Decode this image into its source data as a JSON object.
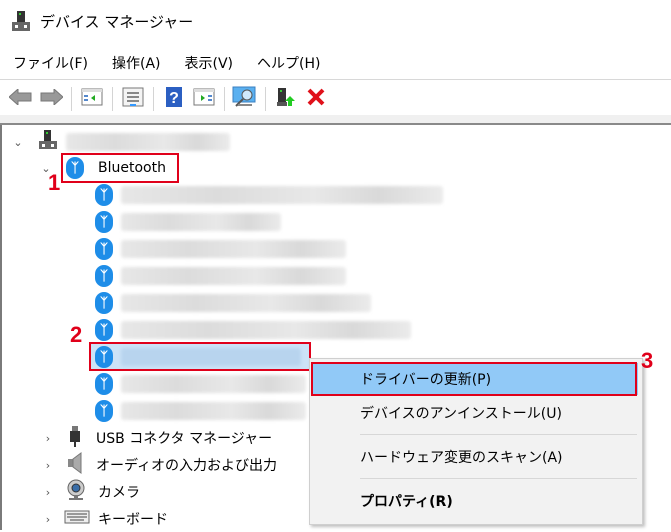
{
  "window": {
    "title": "デバイス マネージャー",
    "app_icon": "device-manager-icon"
  },
  "menubar": {
    "items": [
      {
        "label": "ファイル(F)"
      },
      {
        "label": "操作(A)"
      },
      {
        "label": "表示(V)"
      },
      {
        "label": "ヘルプ(H)"
      }
    ]
  },
  "toolbar": {
    "buttons": [
      {
        "icon": "back-arrow-icon"
      },
      {
        "icon": "forward-arrow-icon"
      },
      {
        "icon": "show-hide-console-tree-icon"
      },
      {
        "icon": "properties-icon"
      },
      {
        "icon": "help-icon"
      },
      {
        "icon": "show-hide-action-pane-icon"
      },
      {
        "icon": "scan-hardware-icon"
      },
      {
        "icon": "update-driver-icon"
      },
      {
        "icon": "uninstall-icon"
      }
    ]
  },
  "tree": {
    "root": {
      "label": "",
      "blurred": true
    },
    "bluetooth": {
      "label": "Bluetooth",
      "expanded": true,
      "child_count": 9
    },
    "categories": [
      {
        "label": "USB コネクタ マネージャー",
        "icon": "usb-connector-icon"
      },
      {
        "label": "オーディオの入力および出力",
        "icon": "speaker-icon"
      },
      {
        "label": "カメラ",
        "icon": "camera-icon"
      },
      {
        "label": "キーボード",
        "icon": "keyboard-icon"
      }
    ]
  },
  "context_menu": {
    "items": [
      {
        "label": "ドライバーの更新(P)",
        "highlighted": true
      },
      {
        "label": "デバイスのアンインストール(U)"
      },
      {
        "label": "ハードウェア変更のスキャン(A)"
      },
      {
        "label": "プロパティ(R)",
        "bold": true
      }
    ]
  },
  "annotations": {
    "step1": "1",
    "step2": "2",
    "step3": "3",
    "color": "#e0001a"
  }
}
